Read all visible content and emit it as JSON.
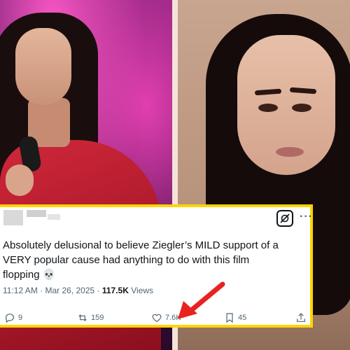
{
  "tweet": {
    "text": "Absolutely delusional to believe Ziegler’s MILD support of a VERY popular cause had anything to do with this film flopping 💀",
    "timestamp": "11:12 AM · Mar 26, 2025 · ",
    "views_count": "117.5K",
    "views_label": " Views",
    "more_label": "···",
    "actions": {
      "replies": "9",
      "reposts": "159",
      "likes": "7.6K",
      "bookmarks": "45"
    }
  },
  "colors": {
    "highlight_border": "#ffd400",
    "arrow": "#e8231f"
  }
}
